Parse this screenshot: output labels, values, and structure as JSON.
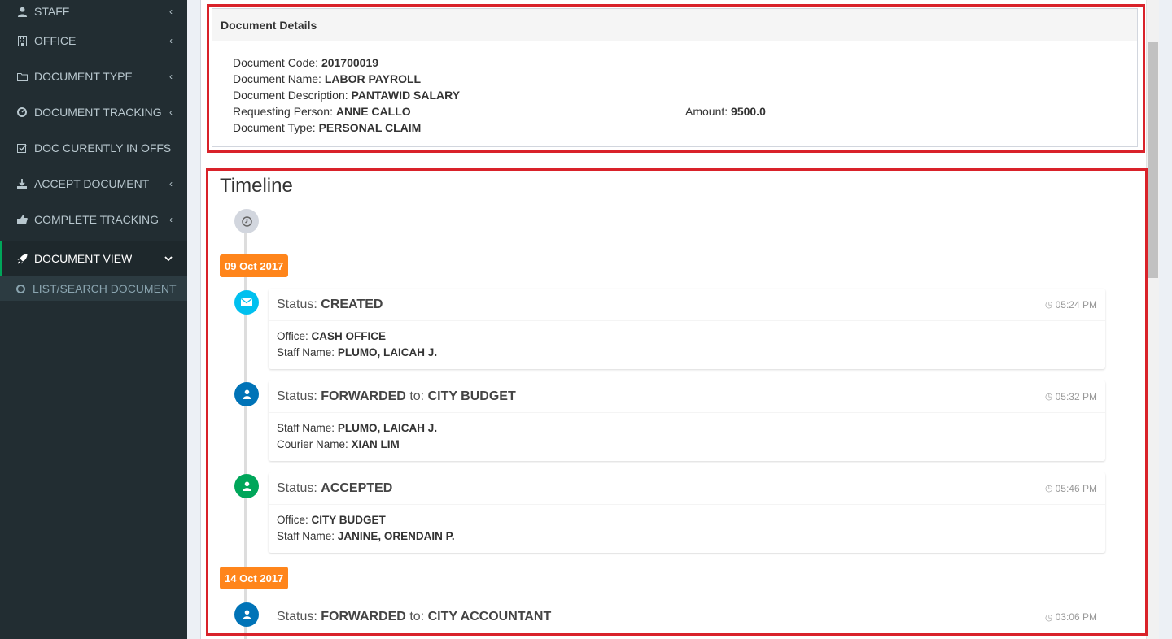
{
  "sidebar": {
    "items": [
      {
        "label": "STAFF",
        "icon": "user-icon"
      },
      {
        "label": "OFFICE",
        "icon": "building-icon"
      },
      {
        "label": "DOCUMENT TYPE",
        "icon": "folder-icon"
      },
      {
        "label": "DOCUMENT TRACKING",
        "icon": "dashboard-icon"
      },
      {
        "label": "DOC CURENTLY IN OFFS",
        "icon": "check-square-icon"
      },
      {
        "label": "ACCEPT DOCUMENT",
        "icon": "download-icon"
      },
      {
        "label": "COMPLETE TRACKING",
        "icon": "thumbs-up-icon"
      },
      {
        "label": "DOCUMENT VIEW",
        "icon": "rocket-icon"
      }
    ],
    "sub_item": "LIST/SEARCH DOCUMENT"
  },
  "document_details": {
    "title": "Document Details",
    "code_label": "Document Code:",
    "code": "201700019",
    "name_label": "Document Name:",
    "name": "LABOR PAYROLL",
    "desc_label": "Document Description:",
    "desc": "PANTAWID SALARY",
    "person_label": "Requesting Person:",
    "person": "ANNE CALLO",
    "type_label": "Document Type:",
    "type": "PERSONAL CLAIM",
    "amount_label": "Amount:",
    "amount": "9500.0"
  },
  "timeline": {
    "title": "Timeline",
    "dates": [
      "09 Oct 2017",
      "14 Oct 2017"
    ],
    "entries": [
      {
        "status_label": "Status:",
        "status": "CREATED",
        "time": "05:24 PM",
        "line1_label": "Office:",
        "line1": "CASH OFFICE",
        "line2_label": "Staff Name:",
        "line2": "PLUMO, LAICAH J."
      },
      {
        "status_label": "Status:",
        "status": "FORWARDED",
        "to_label": "to:",
        "to": "CITY BUDGET",
        "time": "05:32 PM",
        "line1_label": "Staff Name:",
        "line1": "PLUMO, LAICAH J.",
        "line2_label": "Courier Name:",
        "line2": "XIAN LIM"
      },
      {
        "status_label": "Status:",
        "status": "ACCEPTED",
        "time": "05:46 PM",
        "line1_label": "Office:",
        "line1": "CITY BUDGET",
        "line2_label": "Staff Name:",
        "line2": "JANINE, ORENDAIN P."
      },
      {
        "status_label": "Status:",
        "status": "FORWARDED",
        "to_label": "to:",
        "to": "CITY ACCOUNTANT",
        "time": "03:06 PM"
      }
    ]
  },
  "colors": {
    "sidebar_bg": "#222d32",
    "highlight_border": "#d9222a",
    "date_badge": "#ff851b",
    "aqua": "#00c0ef",
    "blue": "#0073b7",
    "green": "#00a65a"
  }
}
